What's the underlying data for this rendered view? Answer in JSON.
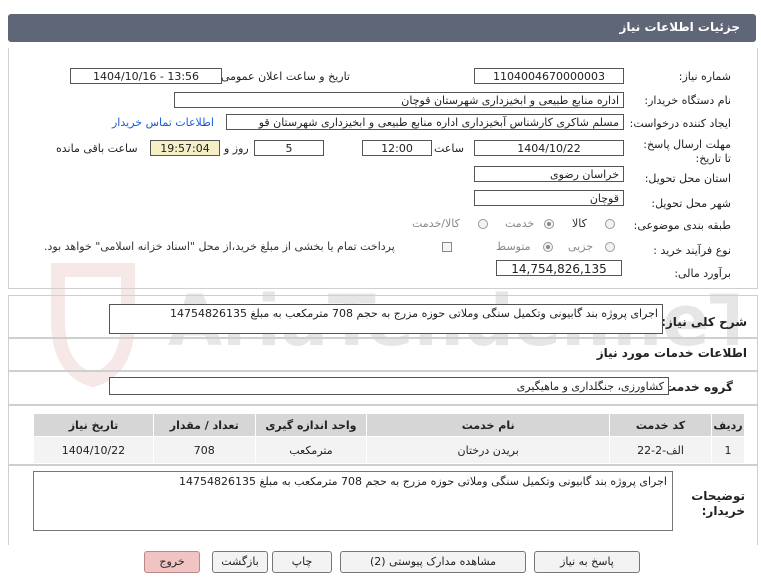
{
  "header": {
    "title": "جزئیات اطلاعات نیاز"
  },
  "fields": {
    "need_number": {
      "label": "شماره نیاز:",
      "value": "1104004670000003"
    },
    "announce_datetime": {
      "label": "تاریخ و ساعت اعلان عمومی:",
      "value": "1404/10/16 - 13:56"
    },
    "buyer_org": {
      "label": "نام دستگاه خریدار:",
      "value": "اداره منابع طبیعی و ابخیزداری شهرستان قوچان"
    },
    "requester": {
      "label": "ایجاد کننده درخواست:",
      "value": "مسلم شاکری کارشناس آبخیزداری اداره منابع طبیعی و ابخیزداری شهرستان قو",
      "contact_link": "اطلاعات تماس خریدار"
    },
    "deadline": {
      "label": "مهلت ارسال پاسخ: تا تاریخ:",
      "date": "1404/10/22",
      "time_label": "ساعت",
      "time": "12:00",
      "days": "5",
      "days_label": "روز و",
      "remaining": "19:57:04",
      "remaining_label": "ساعت باقی مانده"
    },
    "province": {
      "label": "استان محل تحویل:",
      "value": "خراسان رضوی"
    },
    "city": {
      "label": "شهر محل تحویل:",
      "value": "قوچان"
    },
    "category": {
      "label": "طبقه بندی موضوعی:",
      "options": [
        "کالا",
        "خدمت",
        "کالا/خدمت"
      ],
      "selected": "خدمت"
    },
    "process_type": {
      "label": "نوع فرآیند خرید :",
      "options": [
        "جزیی",
        "متوسط"
      ],
      "selected": "متوسط",
      "payment_note": "پرداخت تمام یا بخشی از مبلغ خرید،از محل \"اسناد خزانه اسلامی\" خواهد بود."
    },
    "estimate": {
      "label": "برآورد مالی:",
      "value": "14,754,826,135"
    }
  },
  "summary": {
    "label": "شرح کلی نیاز:",
    "value": "اجرای پروژه بند گابیونی وتکمیل سنگی وملاتی حوزه مزرج به حجم 708 مترمکعب به مبلغ 14754826135"
  },
  "services": {
    "title": "اطلاعات خدمات مورد نیاز",
    "group_label": "گروه خدمت:",
    "group_value": "کشاورزی، جنگلداری و ماهیگیری",
    "table": {
      "headers": [
        "ردیف",
        "کد خدمت",
        "نام خدمت",
        "واحد اندازه گیری",
        "تعداد / مقدار",
        "تاریخ نیاز"
      ],
      "rows": [
        [
          "1",
          "الف-2-22",
          "بریدن درختان",
          "مترمکعب",
          "708",
          "1404/10/22"
        ]
      ]
    }
  },
  "buyer_notes": {
    "label": "توضیحات خریدار:",
    "value": "اجرای پروژه بند گابیونی وتکمیل سنگی وملاتی حوزه مزرج به حجم 708 مترمکعب به مبلغ 14754826135"
  },
  "buttons": {
    "reply": "پاسخ به نیاز",
    "attachments": "مشاهده مدارک پیوستی (2)",
    "print": "چاپ",
    "back": "بازگشت",
    "exit": "خروج"
  },
  "watermark": {
    "text": "AriaTender.neT"
  },
  "colors": {
    "header_bg": "#5e6678",
    "link": "#1a5ad8",
    "exit_button": "#f2c3c3",
    "remaining_bg": "#f4f0c4"
  }
}
